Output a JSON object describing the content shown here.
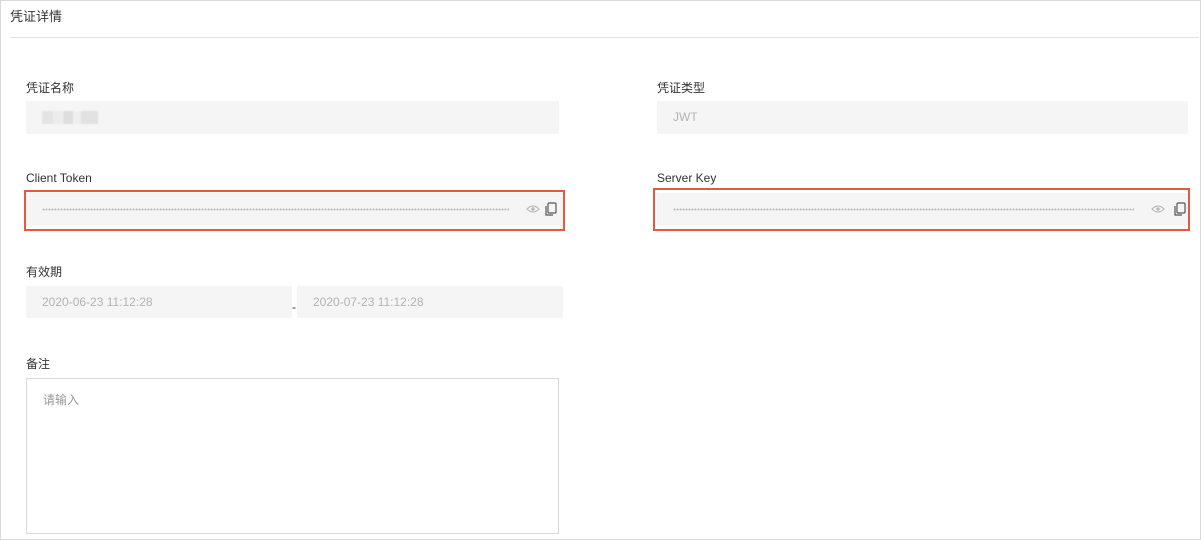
{
  "page": {
    "title": "凭证详情"
  },
  "fields": {
    "name_label": "凭证名称",
    "type_label": "凭证类型",
    "type_value": "JWT",
    "client_token_label": "Client Token",
    "server_key_label": "Server Key",
    "validity_label": "有效期",
    "start_date": "2020-06-23 11:12:28",
    "separator": "-",
    "end_date": "2020-07-23 11:12:28",
    "remark_label": "备注",
    "remark_placeholder": "请输入"
  },
  "icons": {
    "reveal": "eye-icon",
    "copy": "copy-icon"
  },
  "colors": {
    "highlight": "#e65a3b",
    "field_bg": "#f5f5f5"
  }
}
